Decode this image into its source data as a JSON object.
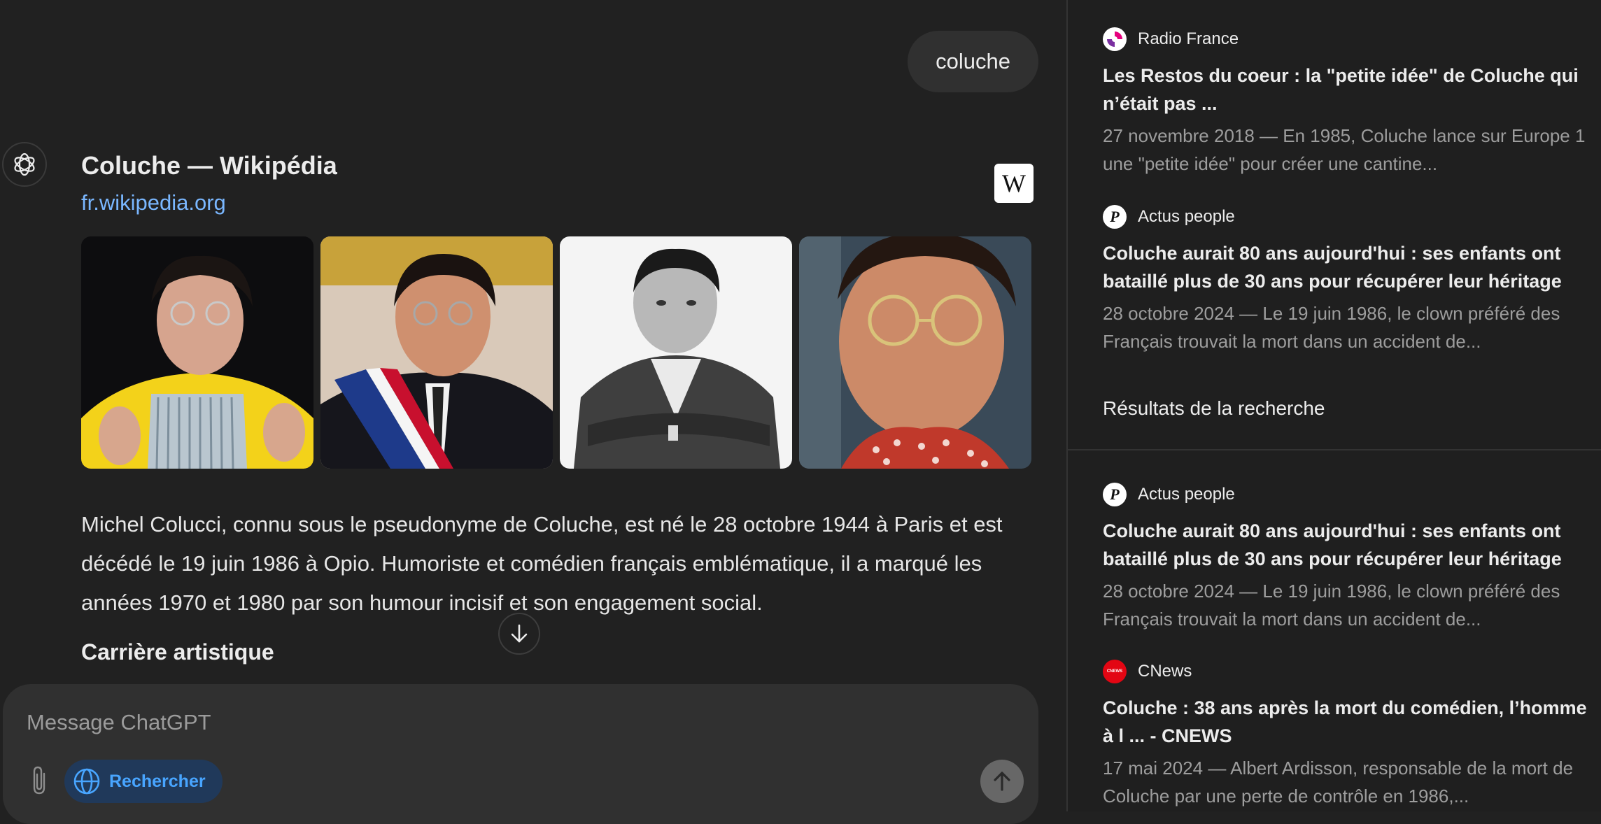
{
  "conversation": {
    "user_message": "coluche"
  },
  "result": {
    "title": "Coluche — Wikipédia",
    "domain": "fr.wikipedia.org",
    "wiki_logo": "W",
    "images": [
      {
        "name": "photo-overalls-yellow-shirt"
      },
      {
        "name": "photo-tricolor-sash"
      },
      {
        "name": "photo-black-and-white-portrait"
      },
      {
        "name": "photo-red-scarf-closeup"
      }
    ],
    "summary": "Michel Colucci, connu sous le pseudonyme de Coluche, est né le 28 octobre 1944 à Paris et est décédé le 19 juin 1986 à Opio. Humoriste et comédien français emblématique, il a marqué les années 1970 et 1980 par son humour incisif et son engagement social.",
    "section_heading": "Carrière artistique"
  },
  "composer": {
    "placeholder": "Message ChatGPT",
    "search_label": "Rechercher"
  },
  "sources_panel": {
    "top_sources": [
      {
        "site": "Radio France",
        "favicon_color": "#e6007e",
        "title": "Les Restos du coeur : la \"petite idée\" de Coluche qui n’était pas ...",
        "snippet": "27 novembre 2018 — En 1985, Coluche lance sur Europe 1 une \"petite idée\" pour créer une cantine..."
      },
      {
        "site": "Actus people",
        "favicon_glyph": "P",
        "title": "Coluche aurait 80 ans aujourd'hui : ses enfants ont bataillé plus de 30 ans pour récupérer leur héritage",
        "snippet": "28 octobre 2024 — Le 19 juin 1986, le clown préféré des Français trouvait la mort dans un accident de..."
      }
    ],
    "results_heading": "Résultats de la recherche",
    "search_results": [
      {
        "site": "Actus people",
        "favicon_glyph": "P",
        "title": "Coluche aurait 80 ans aujourd'hui : ses enfants ont bataillé plus de 30 ans pour récupérer leur héritage",
        "snippet": "28 octobre 2024 — Le 19 juin 1986, le clown préféré des Français trouvait la mort dans un accident de..."
      },
      {
        "site": "CNews",
        "favicon_glyph": "CNEWS",
        "favicon_color": "#e30613",
        "title": "Coluche : 38 ans après la mort du comédien, l’homme à l ... - CNEWS",
        "snippet": "17 mai 2024 — Albert Ardisson, responsable de la mort de Coluche par une perte de contrôle en 1986,..."
      }
    ]
  }
}
